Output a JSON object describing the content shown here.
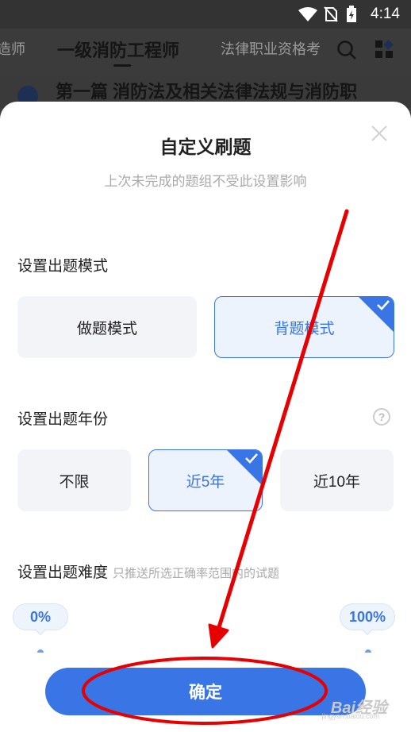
{
  "status_bar": {
    "time": "4:14"
  },
  "header": {
    "tabs": [
      {
        "label": "造师"
      },
      {
        "label": "一级消防工程师"
      },
      {
        "label": "法律职业资格考"
      }
    ]
  },
  "background": {
    "chapter_text": "第一篇 消防法及相关法律法规与消防职"
  },
  "sheet": {
    "title": "自定义刷题",
    "subtitle": "上次未完成的题组不受此设置影响",
    "mode": {
      "label": "设置出题模式",
      "options": [
        {
          "label": "做题模式",
          "selected": false
        },
        {
          "label": "背题模式",
          "selected": true
        }
      ]
    },
    "year": {
      "label": "设置出题年份",
      "help": "?",
      "options": [
        {
          "label": "不限",
          "selected": false
        },
        {
          "label": "近5年",
          "selected": true
        },
        {
          "label": "近10年",
          "selected": false
        }
      ]
    },
    "difficulty": {
      "label": "设置出题难度",
      "hint": "只推送所选正确率范围内的试题",
      "min_label": "0%",
      "max_label": "100%"
    },
    "confirm_label": "确定"
  },
  "colors": {
    "accent": "#3a75e6",
    "annotation": "#e60000"
  },
  "watermark": {
    "text": "Bai经验",
    "sub": "jingyan.baidu.com"
  }
}
